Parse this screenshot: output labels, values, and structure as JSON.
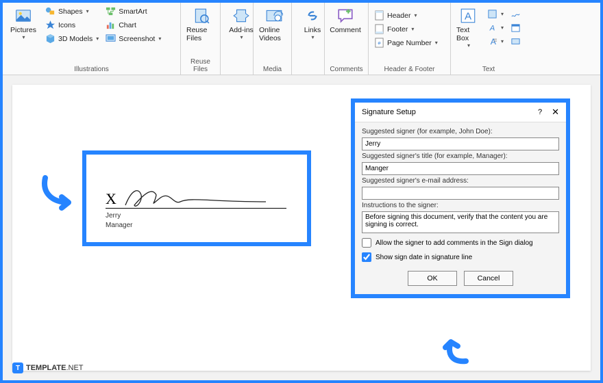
{
  "ribbon": {
    "groups": {
      "illustrations": {
        "label": "Illustrations",
        "pictures": "Pictures",
        "shapes": "Shapes",
        "icons": "Icons",
        "models3d": "3D Models",
        "smartart": "SmartArt",
        "chart": "Chart",
        "screenshot": "Screenshot"
      },
      "reuse": {
        "label": "Reuse Files",
        "btn": "Reuse Files"
      },
      "addins": {
        "label": "",
        "btn": "Add-ins"
      },
      "media": {
        "label": "Media",
        "btn": "Online Videos"
      },
      "links": {
        "label": "",
        "btn": "Links"
      },
      "comments": {
        "label": "Comments",
        "btn": "Comment"
      },
      "headerfooter": {
        "label": "Header & Footer",
        "header": "Header",
        "footer": "Footer",
        "pagenum": "Page Number"
      },
      "text": {
        "label": "Text",
        "textbox": "Text Box"
      }
    }
  },
  "signature_box": {
    "x": "X",
    "signer_name": "Jerry",
    "signer_title": "Manager"
  },
  "dialog": {
    "title": "Signature Setup",
    "labels": {
      "signer": "Suggested signer (for example, John Doe):",
      "title": "Suggested signer's title (for example, Manager):",
      "email": "Suggested signer's e-mail address:",
      "instructions": "Instructions to the signer:"
    },
    "values": {
      "signer": "Jerry",
      "title": "Manger",
      "email": "",
      "instructions": "Before signing this document, verify that the content you are signing is correct."
    },
    "checkboxes": {
      "comments": "Allow the signer to add comments in the Sign dialog",
      "date": "Show sign date in signature line"
    },
    "checked": {
      "comments": false,
      "date": true
    },
    "buttons": {
      "ok": "OK",
      "cancel": "Cancel"
    }
  },
  "footer": {
    "brand": "TEMPLATE",
    "suffix": ".NET"
  }
}
